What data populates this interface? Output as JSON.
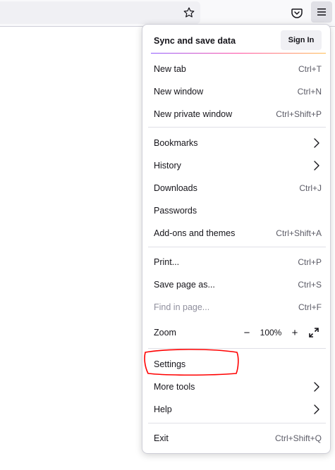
{
  "toolbar": {
    "icons": [
      "star-icon",
      "pocket-icon",
      "hamburger-menu-icon"
    ]
  },
  "menu": {
    "sync_label": "Sync and save data",
    "signin_label": "Sign In",
    "items": [
      {
        "label": "New tab",
        "shortcut": "Ctrl+T"
      },
      {
        "label": "New window",
        "shortcut": "Ctrl+N"
      },
      {
        "label": "New private window",
        "shortcut": "Ctrl+Shift+P"
      },
      {
        "label": "Bookmarks"
      },
      {
        "label": "History"
      },
      {
        "label": "Downloads",
        "shortcut": "Ctrl+J"
      },
      {
        "label": "Passwords"
      },
      {
        "label": "Add-ons and themes",
        "shortcut": "Ctrl+Shift+A"
      },
      {
        "label": "Print...",
        "shortcut": "Ctrl+P"
      },
      {
        "label": "Save page as...",
        "shortcut": "Ctrl+S"
      },
      {
        "label": "Find in page...",
        "shortcut": "Ctrl+F"
      },
      {
        "label": "Settings"
      },
      {
        "label": "More tools"
      },
      {
        "label": "Help"
      },
      {
        "label": "Exit",
        "shortcut": "Ctrl+Shift+Q"
      }
    ],
    "zoom": {
      "label": "Zoom",
      "minus": "−",
      "plus": "+",
      "value": "100%"
    }
  },
  "annotation": {
    "color": "#ff0000",
    "target": "Settings"
  }
}
